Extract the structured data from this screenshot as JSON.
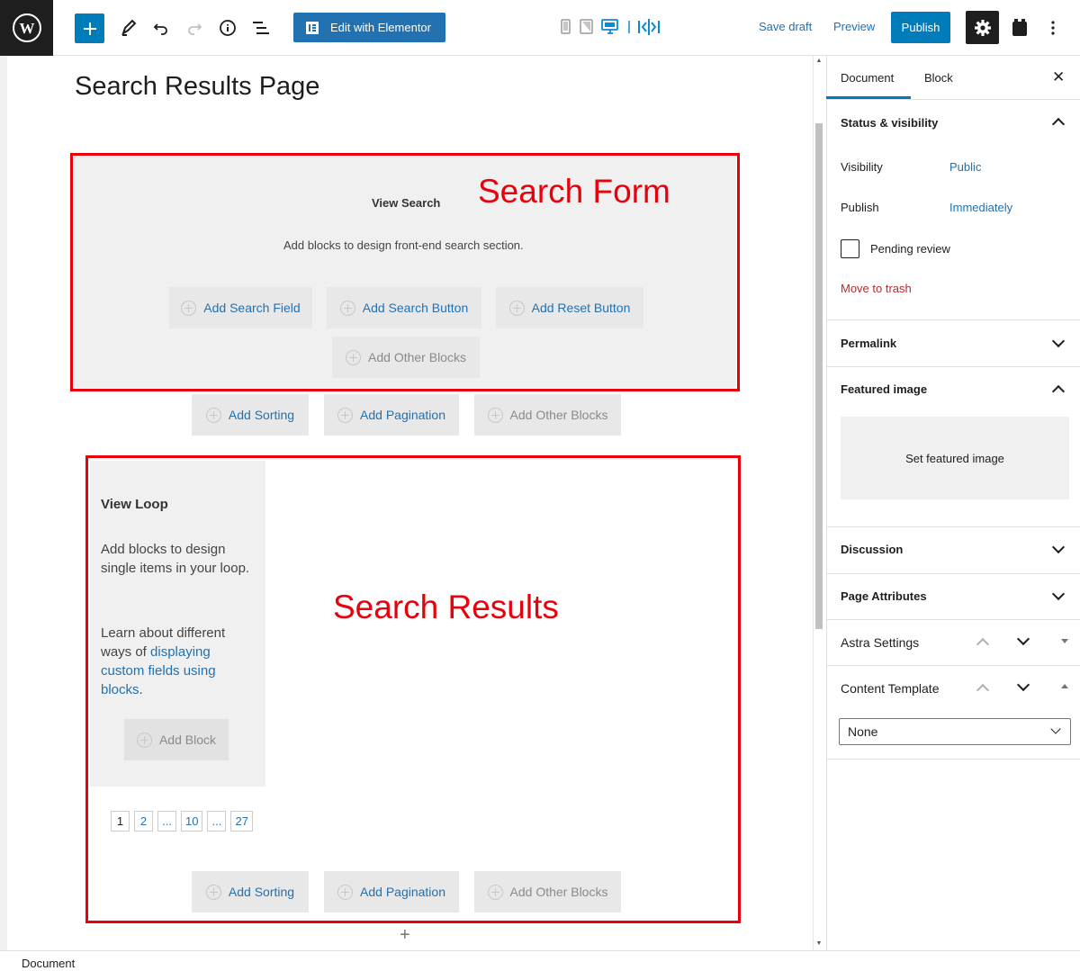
{
  "toolbar": {
    "logo": "wordpress-icon",
    "edit_elementor_label": "Edit with Elementor",
    "save_draft_label": "Save draft",
    "preview_label": "Preview",
    "publish_label": "Publish",
    "icons": [
      "plus-icon",
      "pencil-icon",
      "undo-icon",
      "redo-icon",
      "info-icon",
      "list-view-icon",
      "mobile-icon",
      "tablet-icon",
      "desktop-icon",
      "responsive-split-icon",
      "gear-icon",
      "block-manager-icon",
      "more-options-icon"
    ]
  },
  "editor": {
    "page_title": "Search Results Page",
    "view_search": {
      "title": "View Search",
      "description": "Add blocks to design front-end search section.",
      "buttons": [
        "Add Search Field",
        "Add Search Button",
        "Add Reset Button",
        "Add Other Blocks"
      ]
    },
    "controls_top": [
      "Add Sorting",
      "Add Pagination",
      "Add Other Blocks"
    ],
    "view_loop": {
      "title": "View Loop",
      "description": "Add blocks to design single items in your loop.",
      "learn_prefix": "Learn about different ways of",
      "learn_link": "displaying custom fields using blocks",
      "learn_suffix": ".",
      "add_block": "Add Block"
    },
    "pagination": [
      "1",
      "2",
      "...",
      "10",
      "...",
      "27"
    ],
    "controls_bottom": [
      "Add Sorting",
      "Add Pagination",
      "Add Other Blocks"
    ],
    "annotations": {
      "search_form": "Search Form",
      "search_results": "Search Results"
    }
  },
  "sidebar": {
    "tabs": [
      "Document",
      "Block"
    ],
    "status_visibility": {
      "title": "Status & visibility",
      "visibility_label": "Visibility",
      "visibility_value": "Public",
      "publish_label": "Publish",
      "publish_value": "Immediately",
      "pending_review": "Pending review",
      "move_to_trash": "Move to trash"
    },
    "permalink": "Permalink",
    "featured_image": {
      "title": "Featured image",
      "set_label": "Set featured image"
    },
    "discussion": "Discussion",
    "page_attributes": "Page Attributes",
    "astra_settings": "Astra Settings",
    "content_template": {
      "title": "Content Template",
      "selected": "None"
    }
  },
  "footer": {
    "breadcrumb": "Document"
  },
  "colors": {
    "accent": "#007cba",
    "annotation": "#e8000b",
    "trash": "#b32d2e"
  }
}
